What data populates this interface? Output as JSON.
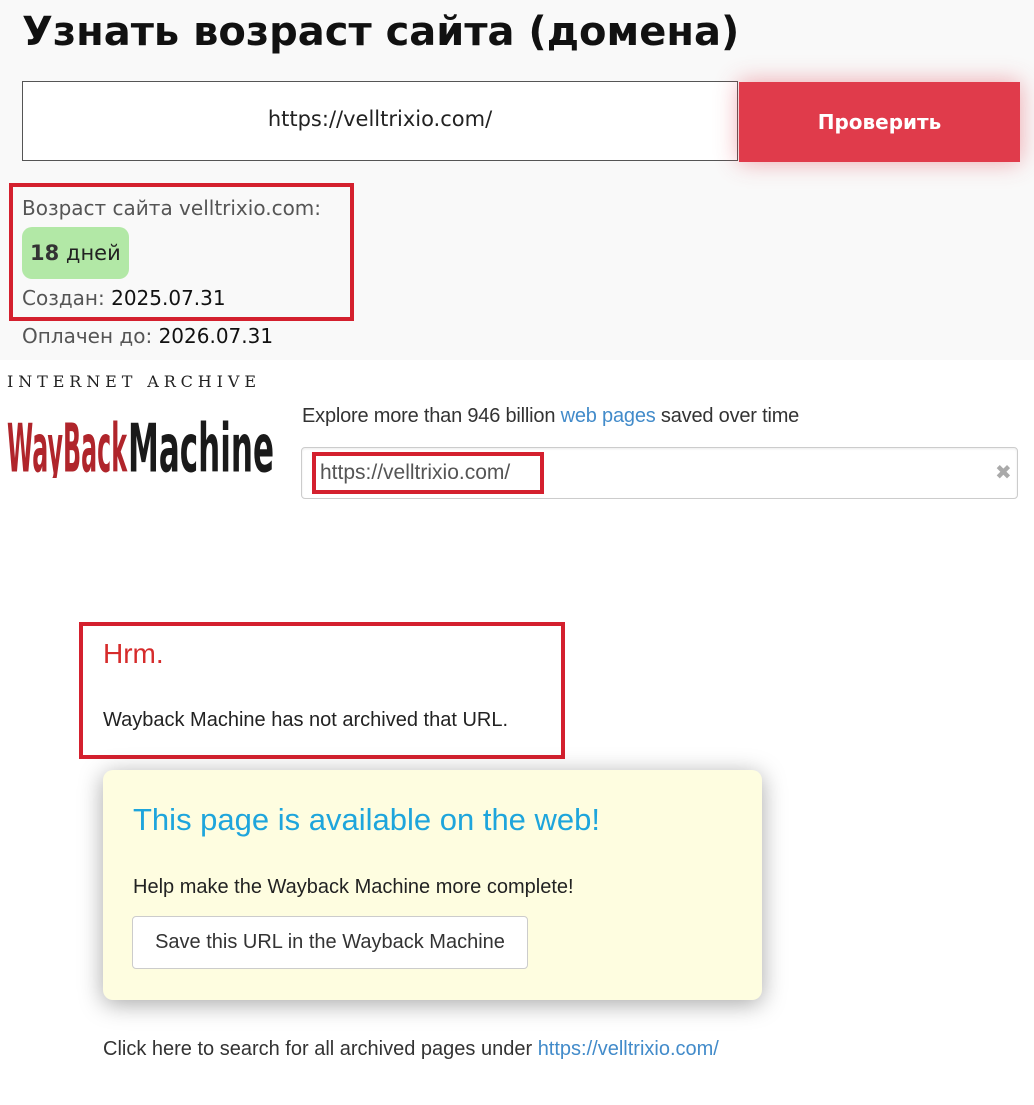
{
  "top": {
    "title": "Узнать возраст сайта (домена)",
    "input_value": "https://velltrixio.com/",
    "check_button": "Проверить",
    "age_label": "Возраст сайта velltrixio.com:",
    "age_number": "18",
    "age_unit": "дней",
    "created_label": "Создан:",
    "created_value": "2025.07.31",
    "paid_label": "Оплачен до:",
    "paid_value": "2026.07.31",
    "accent_color": "#e03b4b",
    "badge_color": "#b2e8a6"
  },
  "wayback": {
    "logo_top_text": "INTERNET ARCHIVE",
    "logo_word_1": "WayBack",
    "logo_word_2": "Machine",
    "explore_prefix": "Explore more than 946 billion",
    "explore_link": "web pages",
    "explore_suffix": "saved over time",
    "search_value": "https://velltrixio.com/",
    "clear_icon": "close-icon",
    "hrm_title": "Hrm.",
    "hrm_message": "Wayback Machine has not archived that URL.",
    "available_title": "This page is available on the web!",
    "help_text": "Help make the Wayback Machine more complete!",
    "save_button": "Save this URL in the Wayback Machine",
    "click_here_prefix": "Click here to search for all archived pages under",
    "click_here_link": "https://velltrixio.com/",
    "logo_red": "#b0252b",
    "link_color": "#428bca",
    "title_blue": "#1ea5dc"
  },
  "highlight_color": "#d4202e"
}
